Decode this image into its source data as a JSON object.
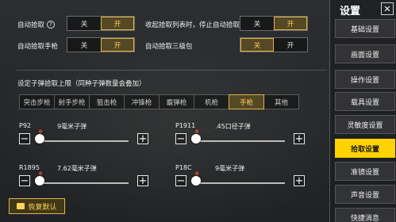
{
  "toggles": [
    {
      "label": "自动拾取",
      "has_help": true,
      "off": "关",
      "on": "开",
      "selected": "on"
    },
    {
      "label": "自动拾取手枪",
      "has_help": false,
      "off": "关",
      "on": "开",
      "selected": "on"
    },
    {
      "label": "收起拾取列表时，停止自动拾取",
      "has_help": false,
      "off": "关",
      "on": "开",
      "selected": "on"
    },
    {
      "label": "自动拾取三级包",
      "has_help": false,
      "off": "关",
      "on": "开",
      "selected": "off"
    }
  ],
  "help_glyph": "?",
  "ammo_section": {
    "title": "设定子弹拾取上限（同种子弹数量会叠加）",
    "tabs": [
      "突击步枪",
      "射手步枪",
      "狙击枪",
      "冲锋枪",
      "霰弹枪",
      "机枪",
      "手枪",
      "其他"
    ],
    "active_tab": "手枪",
    "guns": [
      {
        "name": "P92",
        "ammo": "9毫米子弹",
        "value": "0"
      },
      {
        "name": "P1911",
        "ammo": ".45口径子弹",
        "value": "0"
      },
      {
        "name": "R1895",
        "ammo": "7.62毫米子弹",
        "value": "0"
      },
      {
        "name": "P18C",
        "ammo": "9毫米子弹",
        "value": "0"
      }
    ],
    "minus_glyph": "−",
    "plus_glyph": "+"
  },
  "reset_label": "恢复默认",
  "sidebar": {
    "title": "设置",
    "close_glyph": "✕",
    "items": [
      "基础设置",
      "画面设置",
      "操作设置",
      "载具设置",
      "灵敏度设置",
      "拾取设置",
      "准镜设置",
      "声音设置",
      "快捷消息"
    ],
    "active": "拾取设置"
  },
  "colors": {
    "accent": "#ffd200",
    "selected_text": "#ffd35a",
    "slider_value": "#ff5a3a"
  }
}
